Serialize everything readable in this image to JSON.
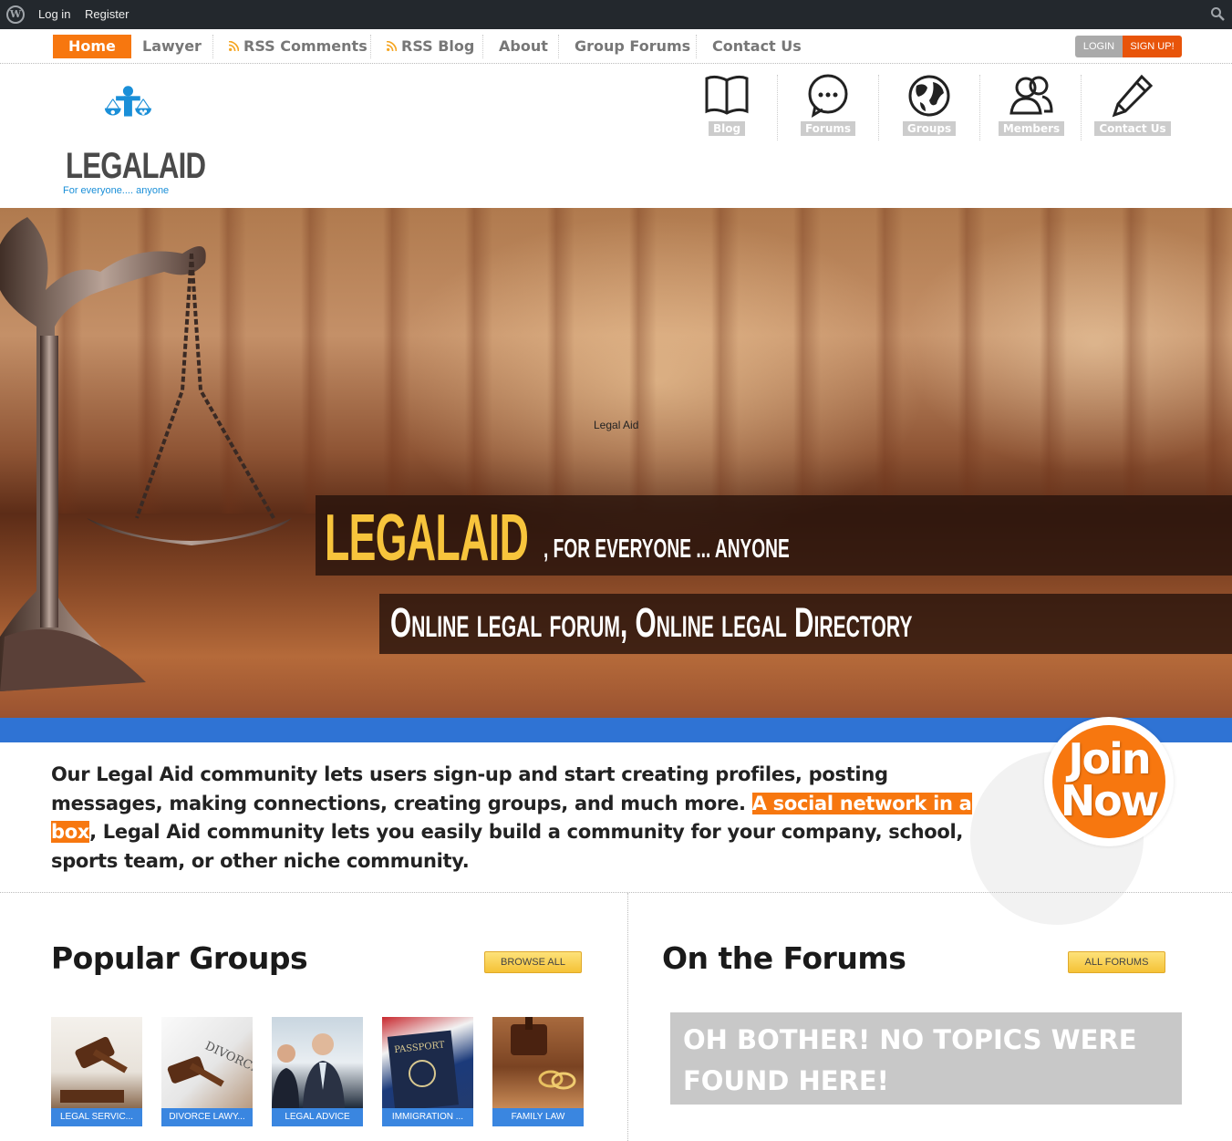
{
  "admin_bar": {
    "login": "Log in",
    "register": "Register"
  },
  "nav": {
    "items": [
      "Home",
      "Lawyer",
      "RSS Comments",
      "RSS Blog",
      "About",
      "Group Forums",
      "Contact Us"
    ],
    "login": "LOGIN",
    "signup": "SIGN UP!"
  },
  "logo": {
    "word": "LEGALAID",
    "tagline": "For everyone.... anyone"
  },
  "icon_nav": [
    {
      "label": "Blog",
      "icon": "book-icon"
    },
    {
      "label": "Forums",
      "icon": "chat-bubble-icon"
    },
    {
      "label": "Groups",
      "icon": "globe-icon"
    },
    {
      "label": "Members",
      "icon": "members-icon"
    },
    {
      "label": "Contact Us",
      "icon": "pencil-icon"
    }
  ],
  "hero": {
    "caption": "Legal Aid",
    "title": "LEGALAID",
    "subtitle": ", FOR EVERYONE ... ANYONE",
    "tagline": "Online legal forum, Online legal Directory"
  },
  "intro": {
    "before": "Our Legal Aid community lets users sign-up and start creating profiles, posting messages, making connections, creating groups, and much more. ",
    "highlight": "A social network in a box",
    "after": ", Legal Aid community lets you easily build a community for your company, school, sports team, or other niche community."
  },
  "join": {
    "line1": "Join",
    "line2": "Now"
  },
  "popular_groups": {
    "title": "Popular Groups",
    "button": "BROWSE ALL",
    "groups": [
      "LEGAL SERVIC...",
      "DIVORCE LAWY...",
      "LEGAL ADVICE",
      "IMMIGRATION ...",
      "FAMILY LAW"
    ]
  },
  "forums": {
    "title": "On the Forums",
    "button": "ALL FORUMS",
    "empty": "OH BOTHER! NO TOPICS WERE FOUND HERE!"
  },
  "colors": {
    "accent": "#f7770f",
    "admin_bar": "#23282d",
    "blue_bar": "#2f73d4",
    "hero_title": "#f7c43c"
  }
}
